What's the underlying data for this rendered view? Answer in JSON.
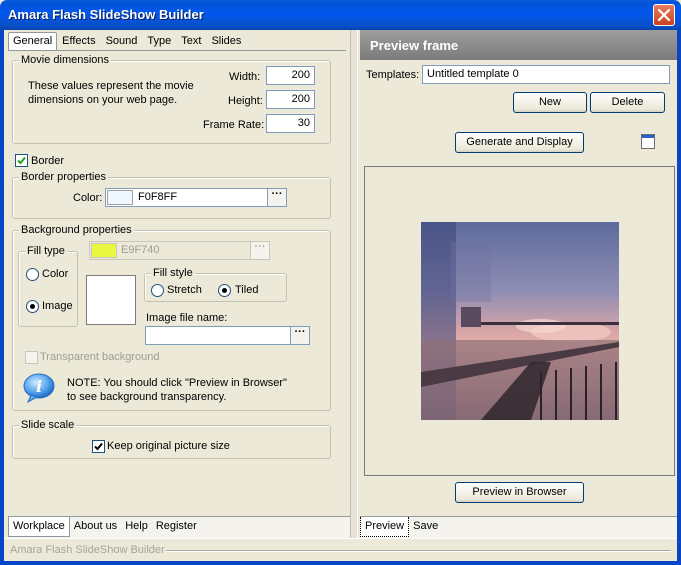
{
  "window": {
    "title": "Amara Flash SlideShow Builder",
    "close_icon": "close-icon"
  },
  "tabs": [
    {
      "label": "General",
      "active": true
    },
    {
      "label": "Effects"
    },
    {
      "label": "Sound"
    },
    {
      "label": "Type"
    },
    {
      "label": "Text"
    },
    {
      "label": "Slides"
    }
  ],
  "movie": {
    "legend": "Movie dimensions",
    "description_line1": "These values represent the movie",
    "description_line2": "dimensions on your web page.",
    "width_label": "Width:",
    "width_value": "200",
    "height_label": "Height:",
    "height_value": "200",
    "framerate_label": "Frame Rate:",
    "framerate_value": "30"
  },
  "border": {
    "checkbox_label": "Border",
    "checked": true,
    "legend": "Border properties",
    "color_label": "Color:",
    "color_value": "F0F8FF",
    "color_swatch": "#f0f8ff",
    "browse_label": "···"
  },
  "background": {
    "legend": "Background properties",
    "color_value": "E9F740",
    "color_swatch": "#e9f740",
    "browse_label": "···",
    "filltype_legend": "Fill type",
    "filltype_color": "Color",
    "filltype_image": "Image",
    "filltype_selected": "Image",
    "fillstyle_legend": "Fill style",
    "fillstyle_stretch": "Stretch",
    "fillstyle_tiled": "Tiled",
    "fillstyle_selected": "Tiled",
    "image_file_label": "Image file name:",
    "image_file_value": "",
    "image_browse_label": "···",
    "transparent_label": "Transparent background",
    "note_line1": "NOTE: You should click \"Preview in Browser\"",
    "note_line2": "to see background transparency.",
    "info_icon": "info-icon"
  },
  "slide_scale": {
    "legend": "Slide scale",
    "keep_label": "Keep original picture size",
    "checked": true
  },
  "bottom_tabs_left": [
    {
      "label": "Workplace",
      "active": true
    },
    {
      "label": "About us"
    },
    {
      "label": "Help"
    },
    {
      "label": "Register"
    }
  ],
  "preview": {
    "header": "Preview frame",
    "templates_label": "Templates:",
    "template_value": "Untitled template 0",
    "new_label": "New",
    "delete_label": "Delete",
    "generate_label": "Generate and Display",
    "preview_browser_label": "Preview in Browser",
    "window_icon": "window-icon"
  },
  "bottom_tabs_right": [
    {
      "label": "Preview",
      "active": true
    },
    {
      "label": "Save"
    }
  ],
  "status": {
    "text": "Amara Flash SlideShow Builder"
  }
}
